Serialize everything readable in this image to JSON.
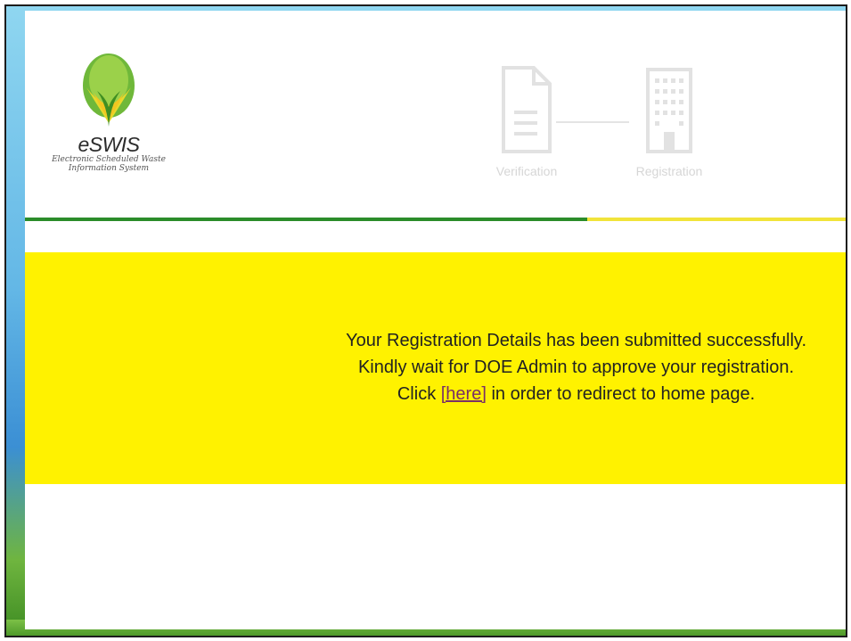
{
  "app": {
    "logo_text": "eSWIS",
    "logo_subtitle_line1": "Electronic Scheduled Waste",
    "logo_subtitle_line2": "Information System"
  },
  "steps": [
    {
      "label": "Verification",
      "icon": "document-icon"
    },
    {
      "label": "Registration",
      "icon": "building-icon"
    }
  ],
  "progress": {
    "fraction": 0.685,
    "fill_color": "#2b8c2a",
    "track_color": "#f1e43a"
  },
  "notice": {
    "background": "#fff200",
    "line1": "Your Registration Details has been submitted successfully.",
    "line2": "Kindly wait for DOE Admin to approve your registration.",
    "line3_before": "Click ",
    "link_text": "[here]",
    "line3_after": " in order to redirect to home page."
  }
}
